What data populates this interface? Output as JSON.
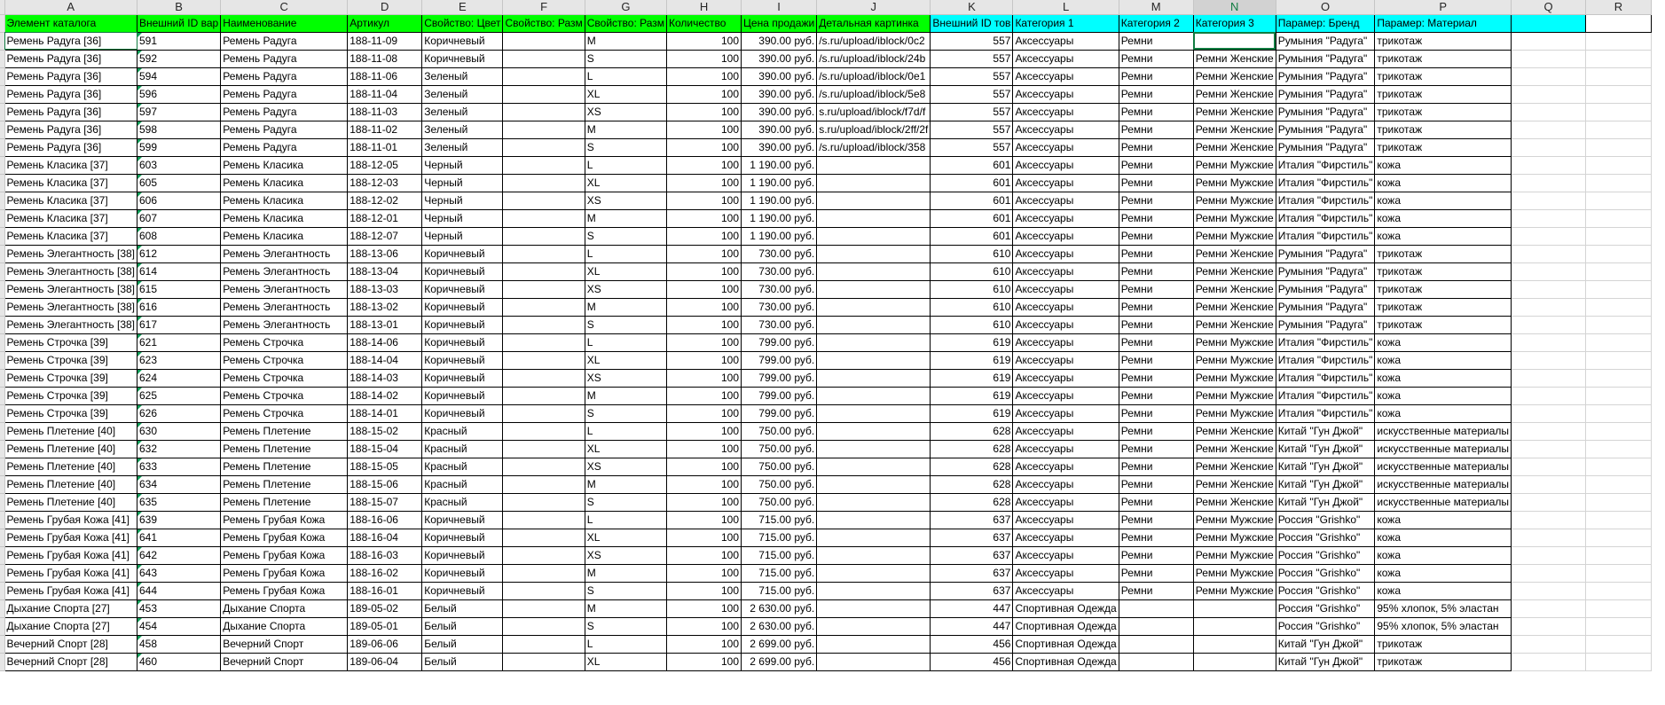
{
  "columns": [
    "A",
    "B",
    "C",
    "D",
    "E",
    "F",
    "G",
    "H",
    "I",
    "J",
    "K",
    "L",
    "M",
    "N",
    "O",
    "P",
    "Q",
    "R"
  ],
  "header": {
    "element": "Элемент каталога",
    "ext_id": "Внешний ID вар",
    "name": "Наименование",
    "article": "Артикул",
    "color": "Свойство: Цвет",
    "size1": "Свойство: Разм",
    "size2": "Свойство: Разм",
    "qty": "Количество",
    "price": "Цена продажи",
    "picture": "Детальная картинка",
    "goods_id": "Внешний ID тов",
    "cat1": "Категория 1",
    "cat2": "Категория 2",
    "cat3": "Категория 3",
    "brand": "Парамер: Бренд",
    "material": "Парамер: Материал"
  },
  "rows": [
    {
      "a": "Ремень Радуга [36]",
      "b": "591",
      "c": "Ремень Радуга",
      "d": "188-11-09",
      "e": "Коричневый",
      "g": "M",
      "h": "100",
      "i": "390.00 руб.",
      "j": "s.ru/upload/iblock/0c2/",
      "k": "557",
      "l": "Аксессуары",
      "m": "Ремни",
      "n": "",
      "o": "Румыния \"Радуга\"",
      "p": "трикотаж"
    },
    {
      "a": "Ремень Радуга [36]",
      "b": "592",
      "c": "Ремень Радуга",
      "d": "188-11-08",
      "e": "Коричневый",
      "g": "S",
      "h": "100",
      "i": "390.00 руб.",
      "j": "s.ru/upload/iblock/24b/",
      "k": "557",
      "l": "Аксессуары",
      "m": "Ремни",
      "n": "Ремни Женские",
      "o": "Румыния \"Радуга\"",
      "p": "трикотаж"
    },
    {
      "a": "Ремень Радуга [36]",
      "b": "594",
      "c": "Ремень Радуга",
      "d": "188-11-06",
      "e": "Зеленый",
      "g": "L",
      "h": "100",
      "i": "390.00 руб.",
      "j": "s.ru/upload/iblock/0e1/",
      "k": "557",
      "l": "Аксессуары",
      "m": "Ремни",
      "n": "Ремни Женские",
      "o": "Румыния \"Радуга\"",
      "p": "трикотаж"
    },
    {
      "a": "Ремень Радуга [36]",
      "b": "596",
      "c": "Ремень Радуга",
      "d": "188-11-04",
      "e": "Зеленый",
      "g": "XL",
      "h": "100",
      "i": "390.00 руб.",
      "j": "s.ru/upload/iblock/5e8/",
      "k": "557",
      "l": "Аксессуары",
      "m": "Ремни",
      "n": "Ремни Женские",
      "o": "Румыния \"Радуга\"",
      "p": "трикотаж"
    },
    {
      "a": "Ремень Радуга [36]",
      "b": "597",
      "c": "Ремень Радуга",
      "d": "188-11-03",
      "e": "Зеленый",
      "g": "XS",
      "h": "100",
      "i": "390.00 руб.",
      "j": "s.ru/upload/iblock/f7d/f",
      "k": "557",
      "l": "Аксессуары",
      "m": "Ремни",
      "n": "Ремни Женские",
      "o": "Румыния \"Радуга\"",
      "p": "трикотаж"
    },
    {
      "a": "Ремень Радуга [36]",
      "b": "598",
      "c": "Ремень Радуга",
      "d": "188-11-02",
      "e": "Зеленый",
      "g": "M",
      "h": "100",
      "i": "390.00 руб.",
      "j": "s.ru/upload/iblock/2ff/2f",
      "k": "557",
      "l": "Аксессуары",
      "m": "Ремни",
      "n": "Ремни Женские",
      "o": "Румыния \"Радуга\"",
      "p": "трикотаж"
    },
    {
      "a": "Ремень Радуга [36]",
      "b": "599",
      "c": "Ремень Радуга",
      "d": "188-11-01",
      "e": "Зеленый",
      "g": "S",
      "h": "100",
      "i": "390.00 руб.",
      "j": "s.ru/upload/iblock/358/",
      "k": "557",
      "l": "Аксессуары",
      "m": "Ремни",
      "n": "Ремни Женские",
      "o": "Румыния \"Радуга\"",
      "p": "трикотаж"
    },
    {
      "a": "Ремень Класика [37]",
      "b": "603",
      "c": "Ремень Класика",
      "d": "188-12-05",
      "e": "Черный",
      "g": "L",
      "h": "100",
      "i": "1 190.00 руб.",
      "j": "",
      "k": "601",
      "l": "Аксессуары",
      "m": "Ремни",
      "n": "Ремни Мужские",
      "o": "Италия \"Фирстиль\"",
      "p": "кожа"
    },
    {
      "a": "Ремень Класика [37]",
      "b": "605",
      "c": "Ремень Класика",
      "d": "188-12-03",
      "e": "Черный",
      "g": "XL",
      "h": "100",
      "i": "1 190.00 руб.",
      "j": "",
      "k": "601",
      "l": "Аксессуары",
      "m": "Ремни",
      "n": "Ремни Мужские",
      "o": "Италия \"Фирстиль\"",
      "p": "кожа"
    },
    {
      "a": "Ремень Класика [37]",
      "b": "606",
      "c": "Ремень Класика",
      "d": "188-12-02",
      "e": "Черный",
      "g": "XS",
      "h": "100",
      "i": "1 190.00 руб.",
      "j": "",
      "k": "601",
      "l": "Аксессуары",
      "m": "Ремни",
      "n": "Ремни Мужские",
      "o": "Италия \"Фирстиль\"",
      "p": "кожа"
    },
    {
      "a": "Ремень Класика [37]",
      "b": "607",
      "c": "Ремень Класика",
      "d": "188-12-01",
      "e": "Черный",
      "g": "M",
      "h": "100",
      "i": "1 190.00 руб.",
      "j": "",
      "k": "601",
      "l": "Аксессуары",
      "m": "Ремни",
      "n": "Ремни Мужские",
      "o": "Италия \"Фирстиль\"",
      "p": "кожа"
    },
    {
      "a": "Ремень Класика [37]",
      "b": "608",
      "c": "Ремень Класика",
      "d": "188-12-07",
      "e": "Черный",
      "g": "S",
      "h": "100",
      "i": "1 190.00 руб.",
      "j": "",
      "k": "601",
      "l": "Аксессуары",
      "m": "Ремни",
      "n": "Ремни Мужские",
      "o": "Италия \"Фирстиль\"",
      "p": "кожа"
    },
    {
      "a": "Ремень Элегантность [38]",
      "b": "612",
      "c": "Ремень Элегантность",
      "d": "188-13-06",
      "e": "Коричневый",
      "g": "L",
      "h": "100",
      "i": "730.00 руб.",
      "j": "",
      "k": "610",
      "l": "Аксессуары",
      "m": "Ремни",
      "n": "Ремни Женские",
      "o": "Румыния \"Радуга\"",
      "p": "трикотаж"
    },
    {
      "a": "Ремень Элегантность [38]",
      "b": "614",
      "c": "Ремень Элегантность",
      "d": "188-13-04",
      "e": "Коричневый",
      "g": "XL",
      "h": "100",
      "i": "730.00 руб.",
      "j": "",
      "k": "610",
      "l": "Аксессуары",
      "m": "Ремни",
      "n": "Ремни Женские",
      "o": "Румыния \"Радуга\"",
      "p": "трикотаж"
    },
    {
      "a": "Ремень Элегантность [38]",
      "b": "615",
      "c": "Ремень Элегантность",
      "d": "188-13-03",
      "e": "Коричневый",
      "g": "XS",
      "h": "100",
      "i": "730.00 руб.",
      "j": "",
      "k": "610",
      "l": "Аксессуары",
      "m": "Ремни",
      "n": "Ремни Женские",
      "o": "Румыния \"Радуга\"",
      "p": "трикотаж"
    },
    {
      "a": "Ремень Элегантность [38]",
      "b": "616",
      "c": "Ремень Элегантность",
      "d": "188-13-02",
      "e": "Коричневый",
      "g": "M",
      "h": "100",
      "i": "730.00 руб.",
      "j": "",
      "k": "610",
      "l": "Аксессуары",
      "m": "Ремни",
      "n": "Ремни Женские",
      "o": "Румыния \"Радуга\"",
      "p": "трикотаж"
    },
    {
      "a": "Ремень Элегантность [38]",
      "b": "617",
      "c": "Ремень Элегантность",
      "d": "188-13-01",
      "e": "Коричневый",
      "g": "S",
      "h": "100",
      "i": "730.00 руб.",
      "j": "",
      "k": "610",
      "l": "Аксессуары",
      "m": "Ремни",
      "n": "Ремни Женские",
      "o": "Румыния \"Радуга\"",
      "p": "трикотаж"
    },
    {
      "a": "Ремень Строчка [39]",
      "b": "621",
      "c": "Ремень Строчка",
      "d": "188-14-06",
      "e": "Коричневый",
      "g": "L",
      "h": "100",
      "i": "799.00 руб.",
      "j": "",
      "k": "619",
      "l": "Аксессуары",
      "m": "Ремни",
      "n": "Ремни Мужские",
      "o": "Италия \"Фирстиль\"",
      "p": "кожа"
    },
    {
      "a": "Ремень Строчка [39]",
      "b": "623",
      "c": "Ремень Строчка",
      "d": "188-14-04",
      "e": "Коричневый",
      "g": "XL",
      "h": "100",
      "i": "799.00 руб.",
      "j": "",
      "k": "619",
      "l": "Аксессуары",
      "m": "Ремни",
      "n": "Ремни Мужские",
      "o": "Италия \"Фирстиль\"",
      "p": "кожа"
    },
    {
      "a": "Ремень Строчка [39]",
      "b": "624",
      "c": "Ремень Строчка",
      "d": "188-14-03",
      "e": "Коричневый",
      "g": "XS",
      "h": "100",
      "i": "799.00 руб.",
      "j": "",
      "k": "619",
      "l": "Аксессуары",
      "m": "Ремни",
      "n": "Ремни Мужские",
      "o": "Италия \"Фирстиль\"",
      "p": "кожа"
    },
    {
      "a": "Ремень Строчка [39]",
      "b": "625",
      "c": "Ремень Строчка",
      "d": "188-14-02",
      "e": "Коричневый",
      "g": "M",
      "h": "100",
      "i": "799.00 руб.",
      "j": "",
      "k": "619",
      "l": "Аксессуары",
      "m": "Ремни",
      "n": "Ремни Мужские",
      "o": "Италия \"Фирстиль\"",
      "p": "кожа"
    },
    {
      "a": "Ремень Строчка [39]",
      "b": "626",
      "c": "Ремень Строчка",
      "d": "188-14-01",
      "e": "Коричневый",
      "g": "S",
      "h": "100",
      "i": "799.00 руб.",
      "j": "",
      "k": "619",
      "l": "Аксессуары",
      "m": "Ремни",
      "n": "Ремни Мужские",
      "o": "Италия \"Фирстиль\"",
      "p": "кожа"
    },
    {
      "a": "Ремень Плетение [40]",
      "b": "630",
      "c": "Ремень Плетение",
      "d": "188-15-02",
      "e": "Красный",
      "g": "L",
      "h": "100",
      "i": "750.00 руб.",
      "j": "",
      "k": "628",
      "l": "Аксессуары",
      "m": "Ремни",
      "n": "Ремни Женские",
      "o": "Китай \"Гун Джой\"",
      "p": "искусственные материалы"
    },
    {
      "a": "Ремень Плетение [40]",
      "b": "632",
      "c": "Ремень Плетение",
      "d": "188-15-04",
      "e": "Красный",
      "g": "XL",
      "h": "100",
      "i": "750.00 руб.",
      "j": "",
      "k": "628",
      "l": "Аксессуары",
      "m": "Ремни",
      "n": "Ремни Женские",
      "o": "Китай \"Гун Джой\"",
      "p": "искусственные материалы"
    },
    {
      "a": "Ремень Плетение [40]",
      "b": "633",
      "c": "Ремень Плетение",
      "d": "188-15-05",
      "e": "Красный",
      "g": "XS",
      "h": "100",
      "i": "750.00 руб.",
      "j": "",
      "k": "628",
      "l": "Аксессуары",
      "m": "Ремни",
      "n": "Ремни Женские",
      "o": "Китай \"Гун Джой\"",
      "p": "искусственные материалы"
    },
    {
      "a": "Ремень Плетение [40]",
      "b": "634",
      "c": "Ремень Плетение",
      "d": "188-15-06",
      "e": "Красный",
      "g": "M",
      "h": "100",
      "i": "750.00 руб.",
      "j": "",
      "k": "628",
      "l": "Аксессуары",
      "m": "Ремни",
      "n": "Ремни Женские",
      "o": "Китай \"Гун Джой\"",
      "p": "искусственные материалы"
    },
    {
      "a": "Ремень Плетение [40]",
      "b": "635",
      "c": "Ремень Плетение",
      "d": "188-15-07",
      "e": "Красный",
      "g": "S",
      "h": "100",
      "i": "750.00 руб.",
      "j": "",
      "k": "628",
      "l": "Аксессуары",
      "m": "Ремни",
      "n": "Ремни Женские",
      "o": "Китай \"Гун Джой\"",
      "p": "искусственные материалы"
    },
    {
      "a": "Ремень Грубая Кожа [41]",
      "b": "639",
      "c": "Ремень Грубая Кожа",
      "d": "188-16-06",
      "e": "Коричневый",
      "g": "L",
      "h": "100",
      "i": "715.00 руб.",
      "j": "",
      "k": "637",
      "l": "Аксессуары",
      "m": "Ремни",
      "n": "Ремни Мужские",
      "o": "Россия \"Grishko\"",
      "p": "кожа"
    },
    {
      "a": "Ремень Грубая Кожа [41]",
      "b": "641",
      "c": "Ремень Грубая Кожа",
      "d": "188-16-04",
      "e": "Коричневый",
      "g": "XL",
      "h": "100",
      "i": "715.00 руб.",
      "j": "",
      "k": "637",
      "l": "Аксессуары",
      "m": "Ремни",
      "n": "Ремни Мужские",
      "o": "Россия \"Grishko\"",
      "p": "кожа"
    },
    {
      "a": "Ремень Грубая Кожа [41]",
      "b": "642",
      "c": "Ремень Грубая Кожа",
      "d": "188-16-03",
      "e": "Коричневый",
      "g": "XS",
      "h": "100",
      "i": "715.00 руб.",
      "j": "",
      "k": "637",
      "l": "Аксессуары",
      "m": "Ремни",
      "n": "Ремни Мужские",
      "o": "Россия \"Grishko\"",
      "p": "кожа"
    },
    {
      "a": "Ремень Грубая Кожа [41]",
      "b": "643",
      "c": "Ремень Грубая Кожа",
      "d": "188-16-02",
      "e": "Коричневый",
      "g": "M",
      "h": "100",
      "i": "715.00 руб.",
      "j": "",
      "k": "637",
      "l": "Аксессуары",
      "m": "Ремни",
      "n": "Ремни Мужские",
      "o": "Россия \"Grishko\"",
      "p": "кожа"
    },
    {
      "a": "Ремень Грубая Кожа [41]",
      "b": "644",
      "c": "Ремень Грубая Кожа",
      "d": "188-16-01",
      "e": "Коричневый",
      "g": "S",
      "h": "100",
      "i": "715.00 руб.",
      "j": "",
      "k": "637",
      "l": "Аксессуары",
      "m": "Ремни",
      "n": "Ремни Мужские",
      "o": "Россия \"Grishko\"",
      "p": "кожа"
    },
    {
      "a": "Дыхание Спорта [27]",
      "b": "453",
      "c": "Дыхание Спорта",
      "d": "189-05-02",
      "e": "Белый",
      "g": "M",
      "h": "100",
      "i": "2 630.00 руб.",
      "j": "",
      "k": "447",
      "l": "Спортивная Одежда",
      "m": "",
      "n": "",
      "o": "Россия \"Grishko\"",
      "p": "95% хлопок, 5% эластан"
    },
    {
      "a": "Дыхание Спорта [27]",
      "b": "454",
      "c": "Дыхание Спорта",
      "d": "189-05-01",
      "e": "Белый",
      "g": "S",
      "h": "100",
      "i": "2 630.00 руб.",
      "j": "",
      "k": "447",
      "l": "Спортивная Одежда",
      "m": "",
      "n": "",
      "o": "Россия \"Grishko\"",
      "p": "95% хлопок, 5% эластан"
    },
    {
      "a": "Вечерний Спорт [28]",
      "b": "458",
      "c": "Вечерний Спорт",
      "d": "189-06-06",
      "e": "Белый",
      "g": "L",
      "h": "100",
      "i": "2 699.00 руб.",
      "j": "",
      "k": "456",
      "l": "Спортивная Одежда",
      "m": "",
      "n": "",
      "o": "Китай \"Гун Джой\"",
      "p": "трикотаж"
    },
    {
      "a": "Вечерний Спорт [28]",
      "b": "460",
      "c": "Вечерний Спорт",
      "d": "189-06-04",
      "e": "Белый",
      "g": "XL",
      "h": "100",
      "i": "2 699.00 руб.",
      "j": "",
      "k": "456",
      "l": "Спортивная Одежда",
      "m": "",
      "n": "",
      "o": "Китай \"Гун Джой\"",
      "p": "трикотаж"
    }
  ]
}
